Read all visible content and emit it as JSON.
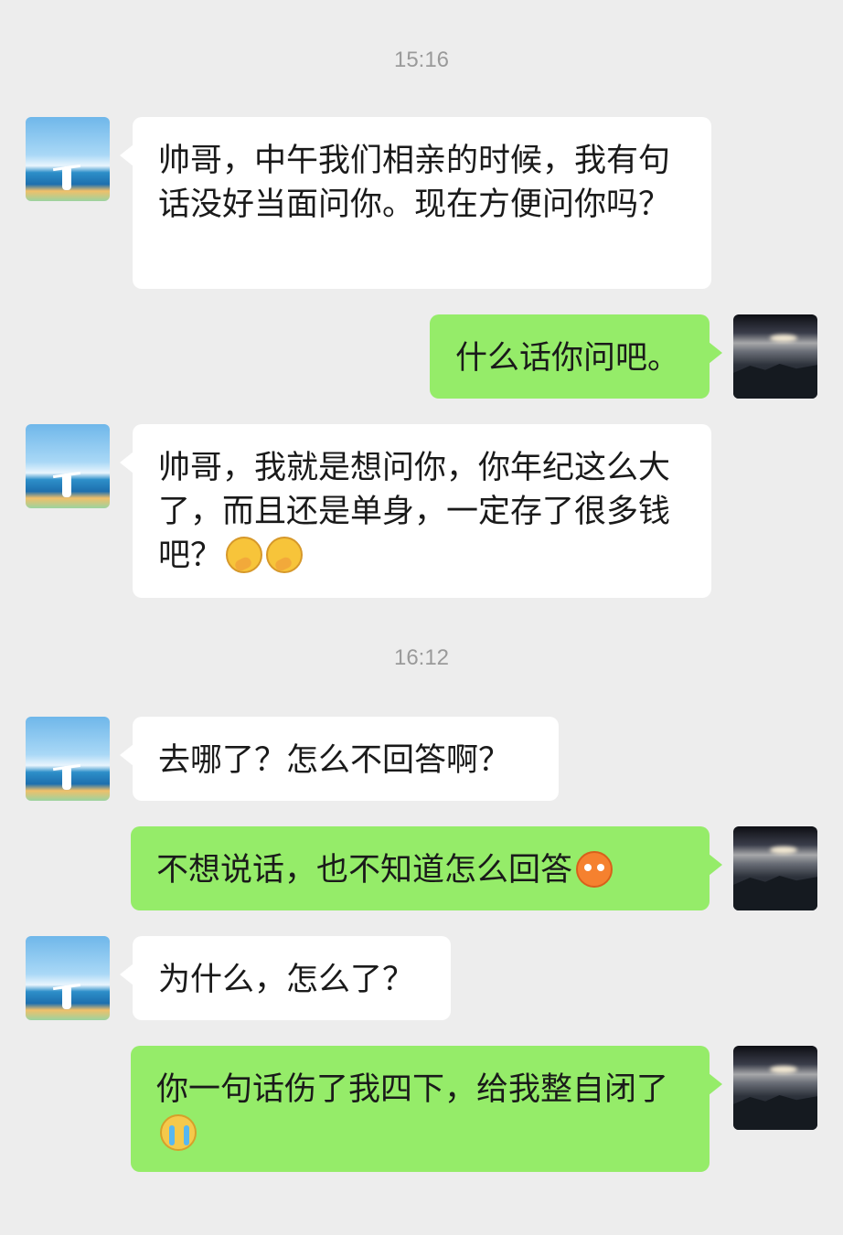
{
  "timestamps": [
    "15:16",
    "16:12"
  ],
  "messages": [
    {
      "side": "left",
      "text": "帅哥，中午我们相亲的时候，我有句话没好当面问你。现在方便问你吗？"
    },
    {
      "side": "right",
      "text": "什么话你问吧。"
    },
    {
      "side": "left",
      "text": "帅哥，我就是想问你，你年纪这么大了，而且还是单身，一定存了很多钱吧？",
      "emoji": "thinking-face-icon ×2"
    },
    {
      "side": "left",
      "text": "去哪了？怎么不回答啊？"
    },
    {
      "side": "right",
      "text": "不想说话，也不知道怎么回答",
      "emoji": "sweat-face-icon"
    },
    {
      "side": "left",
      "text": "为什么，怎么了？"
    },
    {
      "side": "right",
      "text": "你一句话伤了我四下，给我整自闭了",
      "emoji": "crying-face-icon"
    }
  ],
  "colors": {
    "background": "#ededed",
    "left_bubble": "#ffffff",
    "right_bubble": "#95ec69",
    "timestamp": "#9a9a9a"
  }
}
